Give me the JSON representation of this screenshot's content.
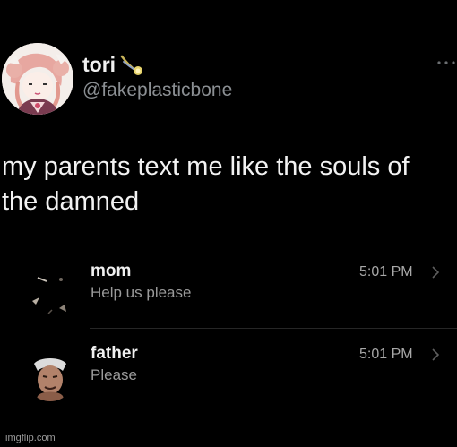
{
  "profile": {
    "display_name": "tori",
    "handle": "@fakeplasticbone",
    "avatar_icon": "anime-avatar-icon",
    "badge_icon": "comet-emoji-icon",
    "menu_icon": "more-options-icon"
  },
  "tweet": {
    "text": "my parents text me like the souls of the damned"
  },
  "messages": [
    {
      "name": "mom",
      "preview": "Help us please",
      "time": "5:01 PM",
      "avatar_icon": "dark-hands-avatar-icon"
    },
    {
      "name": "father",
      "preview": "Please",
      "time": "5:01 PM",
      "avatar_icon": "demon-face-avatar-icon"
    }
  ],
  "watermark": "imgflip.com",
  "colors": {
    "background": "#000000",
    "text_primary": "#f2f2f2",
    "text_secondary": "#8b8f93",
    "preview_text": "#9a9a9a"
  }
}
